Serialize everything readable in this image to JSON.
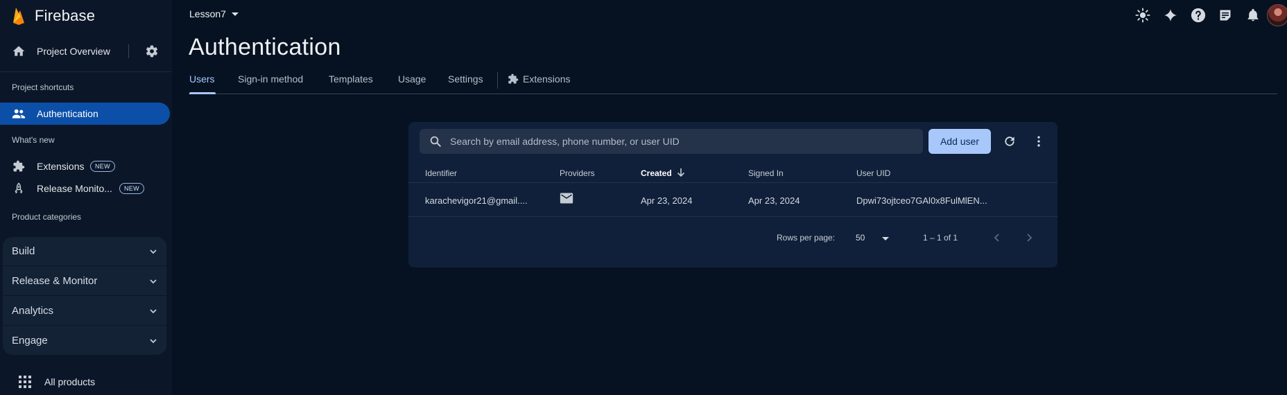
{
  "brand": {
    "name": "Firebase",
    "logo_color": "#f6a716"
  },
  "sidebar": {
    "project_overview": "Project Overview",
    "shortcuts_label": "Project shortcuts",
    "active_item": "Authentication",
    "whats_new_label": "What's new",
    "whats_new_items": [
      {
        "label": "Extensions",
        "badge": "NEW",
        "icon": "extensions-icon"
      },
      {
        "label": "Release Monito...",
        "badge": "NEW",
        "icon": "rocket-icon"
      }
    ],
    "categories_label": "Product categories",
    "categories": [
      "Build",
      "Release & Monitor",
      "Analytics",
      "Engage"
    ],
    "all_products": "All products"
  },
  "header": {
    "project": "Lesson7",
    "icons": [
      "theme-icon",
      "gemini-icon",
      "help-icon",
      "release-notes-icon",
      "notifications-icon",
      "avatar"
    ]
  },
  "page": {
    "title": "Authentication",
    "tabs": [
      "Users",
      "Sign-in method",
      "Templates",
      "Usage",
      "Settings"
    ],
    "extensions_tab": "Extensions",
    "active_tab": "Users"
  },
  "users": {
    "search_placeholder": "Search by email address, phone number, or user UID",
    "add_user": "Add user",
    "columns": [
      "Identifier",
      "Providers",
      "Created",
      "Signed In",
      "User UID"
    ],
    "sorted_column": "Created",
    "rows": [
      {
        "identifier": "karachevigor21@gmail....",
        "provider": "email",
        "created": "Apr 23, 2024",
        "signed_in": "Apr 23, 2024",
        "uid": "Dpwi73ojtceo7GAl0x8FulMlEN..."
      }
    ],
    "rows_per_page_label": "Rows per page:",
    "rows_per_page": "50",
    "range": "1 – 1 of 1"
  },
  "colors": {
    "accent": "#a8c7fa",
    "active_nav": "#0b4fa8",
    "background": "#061222"
  }
}
